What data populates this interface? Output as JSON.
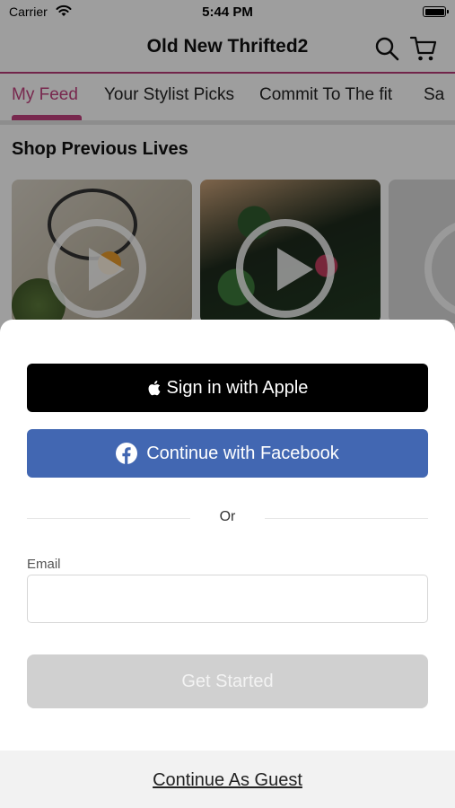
{
  "status_bar": {
    "carrier": "Carrier",
    "time": "5:44 PM"
  },
  "header": {
    "title": "Old New Thrifted2"
  },
  "tabs": [
    {
      "label": "My Feed",
      "active": true
    },
    {
      "label": "Your Stylist Picks",
      "active": false
    },
    {
      "label": "Commit To The fit",
      "active": false
    },
    {
      "label": "Sa",
      "active": false
    }
  ],
  "feed": {
    "section_title": "Shop Previous Lives"
  },
  "login_sheet": {
    "apple_button": "Sign in with Apple",
    "facebook_button": "Continue with Facebook",
    "divider_text": "Or",
    "email": {
      "label": "Email",
      "value": "",
      "placeholder": ""
    },
    "get_started_button": "Get Started",
    "guest_link": "Continue As Guest"
  },
  "colors": {
    "accent": "#c2417f",
    "facebook": "#4267b2",
    "apple": "#000000",
    "disabled_button": "#d0d0d0"
  }
}
